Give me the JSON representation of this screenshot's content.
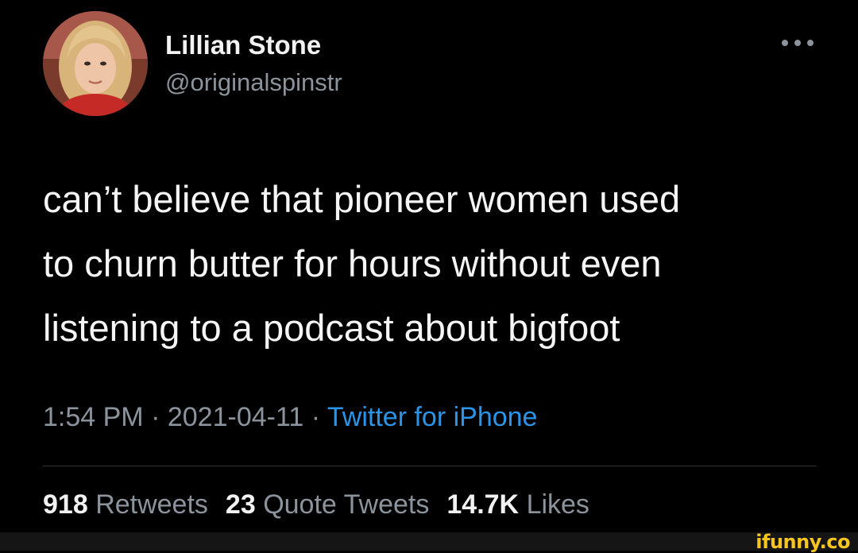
{
  "author": {
    "name": "Lillian Stone",
    "handle": "@originalspinstr"
  },
  "tweet": {
    "lines": [
      "can’t believe that pioneer women used",
      "to churn butter for hours without even",
      "listening to a podcast about bigfoot"
    ]
  },
  "meta": {
    "time": "1:54 PM",
    "date": "2021-04-11",
    "separator": "·",
    "source": "Twitter for iPhone"
  },
  "stats": {
    "retweets_count": "918",
    "retweets_label": "Retweets",
    "quotes_count": "23",
    "quotes_label": "Quote Tweets",
    "likes_count": "14.7K",
    "likes_label": "Likes"
  },
  "watermark": "ifunny.co",
  "colors": {
    "background": "#000000",
    "secondary_text": "#8b949c",
    "link": "#2a95e8",
    "watermark": "#f7c520"
  }
}
